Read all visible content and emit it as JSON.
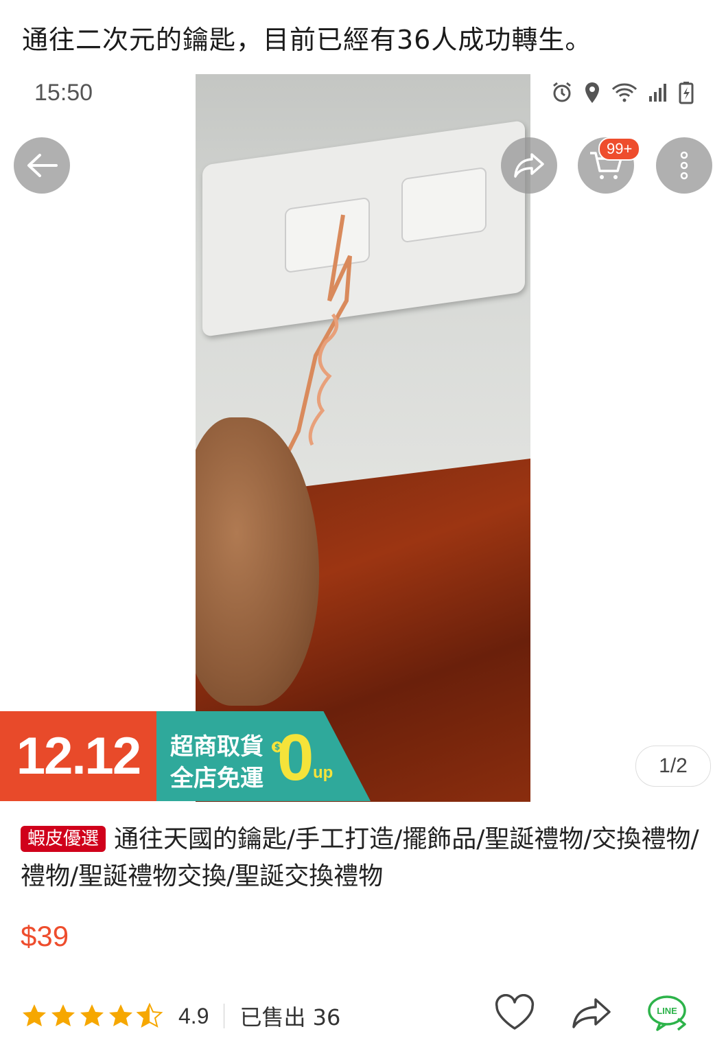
{
  "caption": "通往二次元的鑰匙，目前已經有36人成功轉生。",
  "status_bar": {
    "time": "15:50"
  },
  "cart": {
    "badge": "99+"
  },
  "promo": {
    "date": "12.12",
    "line1": "超商取貨",
    "line2": "全店免運",
    "zero": "0",
    "up": "up",
    "dollar": "$"
  },
  "gallery": {
    "indicator": "1/2"
  },
  "product": {
    "tag": "蝦皮優選",
    "title": "通往天國的鑰匙/手工打造/擺飾品/聖誕禮物/交換禮物/禮物/聖誕禮物交換/聖誕交換禮物",
    "price": "$39",
    "rating": "4.9",
    "rating_stars": 4.5,
    "sold": "已售出 36"
  },
  "colors": {
    "accent": "#ee4d2d",
    "tag_red": "#d0011b",
    "promo_red": "#e84a2a",
    "promo_teal": "#2fa99b",
    "promo_yellow": "#f5e33a",
    "star": "#f6a700",
    "line_green": "#2db34a"
  },
  "icons": [
    "back-arrow-icon",
    "share-icon",
    "cart-icon",
    "more-icon",
    "alarm-icon",
    "location-icon",
    "wifi-icon",
    "signal-icon",
    "battery-icon",
    "star-icon",
    "heart-icon",
    "share-outline-icon",
    "line-icon"
  ]
}
